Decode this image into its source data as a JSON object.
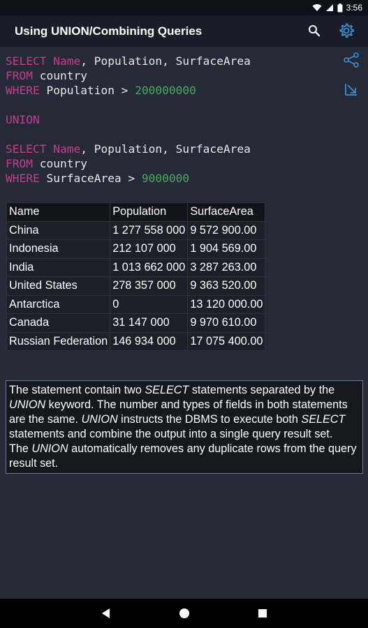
{
  "status_bar": {
    "time": "3:56"
  },
  "app_bar": {
    "title": "Using UNION/Combining Queries"
  },
  "query": {
    "select_kw": "SELECT",
    "col_name": "Name",
    "cols_rest": ", Population, SurfaceArea",
    "from_kw": "FROM",
    "table": " country",
    "where_kw": "WHERE",
    "cond1": " Population > ",
    "val1": "200000000",
    "union_kw": "UNION",
    "cond2": " SurfaceArea > ",
    "val2": "9000000"
  },
  "result": {
    "headers": [
      "Name",
      "Population",
      "SurfaceArea"
    ],
    "rows": [
      [
        "China",
        "1 277 558 000",
        "9 572 900.00"
      ],
      [
        "Indonesia",
        "212 107 000",
        "1 904 569.00"
      ],
      [
        "India",
        "1 013 662 000",
        "3 287 263.00"
      ],
      [
        "United States",
        "278 357 000",
        "9 363 520.00"
      ],
      [
        "Antarctica",
        "0",
        "13 120 000.00"
      ],
      [
        "Canada",
        "31 147 000",
        "9 970 610.00"
      ],
      [
        "Russian Federation",
        "146 934 000",
        "17 075 400.00"
      ]
    ]
  },
  "note": {
    "t1": "The statement contain two ",
    "e1": "SELECT",
    "t2": " statements separated by the ",
    "e2": "UNION",
    "t3": " keyword. The number and types of fields in both statements are the same. ",
    "e3": "UNION",
    "t4": " instructs the DBMS to execute both ",
    "e4": "SELECT",
    "t5": " statements and combine the output into a single query result set.",
    "t6": "The ",
    "e5": "UNION",
    "t7": " automatically removes any duplicate rows from the query result set."
  },
  "colors": {
    "keyword": "#c53c8f",
    "number": "#4aa862",
    "background": "#262a37",
    "accent": "#3d8fd6"
  },
  "icons": {
    "search": "search-icon",
    "settings": "gear-icon",
    "share": "share-icon",
    "export": "export-icon"
  }
}
